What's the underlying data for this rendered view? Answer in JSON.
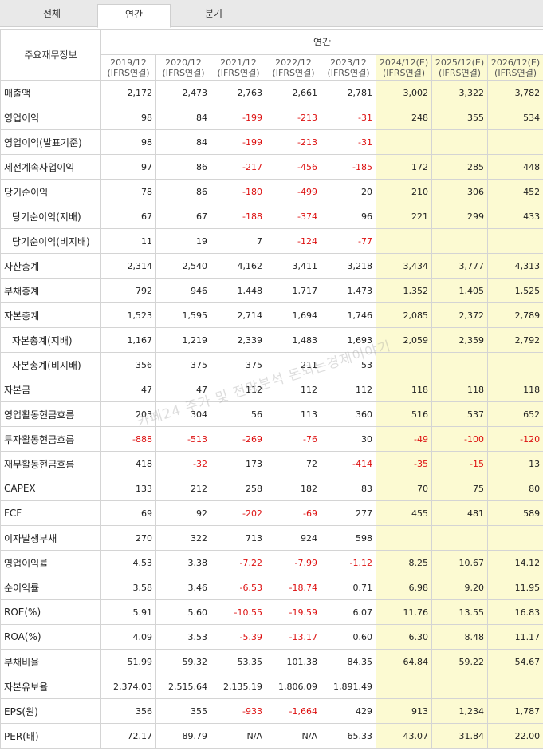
{
  "tabs": [
    {
      "label": "전체",
      "active": false
    },
    {
      "label": "연간",
      "active": true
    },
    {
      "label": "분기",
      "active": false
    }
  ],
  "header": {
    "row_label": "주요재무정보",
    "group": "연간",
    "columns": [
      {
        "period": "2019/12",
        "basis": "(IFRS연결)",
        "estimate": false
      },
      {
        "period": "2020/12",
        "basis": "(IFRS연결)",
        "estimate": false
      },
      {
        "period": "2021/12",
        "basis": "(IFRS연결)",
        "estimate": false
      },
      {
        "period": "2022/12",
        "basis": "(IFRS연결)",
        "estimate": false
      },
      {
        "period": "2023/12",
        "basis": "(IFRS연결)",
        "estimate": false
      },
      {
        "period": "2024/12(E)",
        "basis": "(IFRS연결)",
        "estimate": true
      },
      {
        "period": "2025/12(E)",
        "basis": "(IFRS연결)",
        "estimate": true
      },
      {
        "period": "2026/12(E)",
        "basis": "(IFRS연결)",
        "estimate": true
      }
    ]
  },
  "rows": [
    {
      "label": "매출액",
      "sub": false,
      "values": [
        "2,172",
        "2,473",
        "2,763",
        "2,661",
        "2,781",
        "3,002",
        "3,322",
        "3,782"
      ]
    },
    {
      "label": "영업이익",
      "sub": false,
      "values": [
        "98",
        "84",
        "-199",
        "-213",
        "-31",
        "248",
        "355",
        "534"
      ]
    },
    {
      "label": "영업이익(발표기준)",
      "sub": false,
      "values": [
        "98",
        "84",
        "-199",
        "-213",
        "-31",
        "",
        "",
        ""
      ]
    },
    {
      "label": "세전계속사업이익",
      "sub": false,
      "values": [
        "97",
        "86",
        "-217",
        "-456",
        "-185",
        "172",
        "285",
        "448"
      ]
    },
    {
      "label": "당기순이익",
      "sub": false,
      "values": [
        "78",
        "86",
        "-180",
        "-499",
        "20",
        "210",
        "306",
        "452"
      ]
    },
    {
      "label": "당기순이익(지배)",
      "sub": true,
      "values": [
        "67",
        "67",
        "-188",
        "-374",
        "96",
        "221",
        "299",
        "433"
      ]
    },
    {
      "label": "당기순이익(비지배)",
      "sub": true,
      "values": [
        "11",
        "19",
        "7",
        "-124",
        "-77",
        "",
        "",
        ""
      ]
    },
    {
      "label": "자산총계",
      "sub": false,
      "values": [
        "2,314",
        "2,540",
        "4,162",
        "3,411",
        "3,218",
        "3,434",
        "3,777",
        "4,313"
      ]
    },
    {
      "label": "부채총계",
      "sub": false,
      "values": [
        "792",
        "946",
        "1,448",
        "1,717",
        "1,473",
        "1,352",
        "1,405",
        "1,525"
      ]
    },
    {
      "label": "자본총계",
      "sub": false,
      "values": [
        "1,523",
        "1,595",
        "2,714",
        "1,694",
        "1,746",
        "2,085",
        "2,372",
        "2,789"
      ]
    },
    {
      "label": "자본총계(지배)",
      "sub": true,
      "values": [
        "1,167",
        "1,219",
        "2,339",
        "1,483",
        "1,693",
        "2,059",
        "2,359",
        "2,792"
      ]
    },
    {
      "label": "자본총계(비지배)",
      "sub": true,
      "values": [
        "356",
        "375",
        "375",
        "211",
        "53",
        "",
        "",
        ""
      ]
    },
    {
      "label": "자본금",
      "sub": false,
      "values": [
        "47",
        "47",
        "112",
        "112",
        "112",
        "118",
        "118",
        "118"
      ]
    },
    {
      "label": "영업활동현금흐름",
      "sub": false,
      "values": [
        "203",
        "304",
        "56",
        "113",
        "360",
        "516",
        "537",
        "652"
      ]
    },
    {
      "label": "투자활동현금흐름",
      "sub": false,
      "values": [
        "-888",
        "-513",
        "-269",
        "-76",
        "30",
        "-49",
        "-100",
        "-120"
      ]
    },
    {
      "label": "재무활동현금흐름",
      "sub": false,
      "values": [
        "418",
        "-32",
        "173",
        "72",
        "-414",
        "-35",
        "-15",
        "13"
      ]
    },
    {
      "label": "CAPEX",
      "sub": false,
      "values": [
        "133",
        "212",
        "258",
        "182",
        "83",
        "70",
        "75",
        "80"
      ]
    },
    {
      "label": "FCF",
      "sub": false,
      "values": [
        "69",
        "92",
        "-202",
        "-69",
        "277",
        "455",
        "481",
        "589"
      ]
    },
    {
      "label": "이자발생부채",
      "sub": false,
      "values": [
        "270",
        "322",
        "713",
        "924",
        "598",
        "",
        "",
        ""
      ]
    },
    {
      "label": "영업이익률",
      "sub": false,
      "values": [
        "4.53",
        "3.38",
        "-7.22",
        "-7.99",
        "-1.12",
        "8.25",
        "10.67",
        "14.12"
      ]
    },
    {
      "label": "순이익률",
      "sub": false,
      "values": [
        "3.58",
        "3.46",
        "-6.53",
        "-18.74",
        "0.71",
        "6.98",
        "9.20",
        "11.95"
      ]
    },
    {
      "label": "ROE(%)",
      "sub": false,
      "values": [
        "5.91",
        "5.60",
        "-10.55",
        "-19.59",
        "6.07",
        "11.76",
        "13.55",
        "16.83"
      ]
    },
    {
      "label": "ROA(%)",
      "sub": false,
      "values": [
        "4.09",
        "3.53",
        "-5.39",
        "-13.17",
        "0.60",
        "6.30",
        "8.48",
        "11.17"
      ]
    },
    {
      "label": "부채비율",
      "sub": false,
      "values": [
        "51.99",
        "59.32",
        "53.35",
        "101.38",
        "84.35",
        "64.84",
        "59.22",
        "54.67"
      ]
    },
    {
      "label": "자본유보율",
      "sub": false,
      "values": [
        "2,374.03",
        "2,515.64",
        "2,135.19",
        "1,806.09",
        "1,891.49",
        "",
        "",
        ""
      ]
    },
    {
      "label": "EPS(원)",
      "sub": false,
      "values": [
        "356",
        "355",
        "-933",
        "-1,664",
        "429",
        "913",
        "1,234",
        "1,787"
      ]
    },
    {
      "label": "PER(배)",
      "sub": false,
      "values": [
        "72.17",
        "89.79",
        "N/A",
        "N/A",
        "65.33",
        "43.07",
        "31.84",
        "22.00"
      ]
    }
  ],
  "watermark": "카페24 주가 및 전망분석 돈되는경제이야기",
  "colors": {
    "negative": "#dd1111",
    "estimate_bg": "#fcfad2",
    "tab_bar": "#e9e9e9"
  }
}
